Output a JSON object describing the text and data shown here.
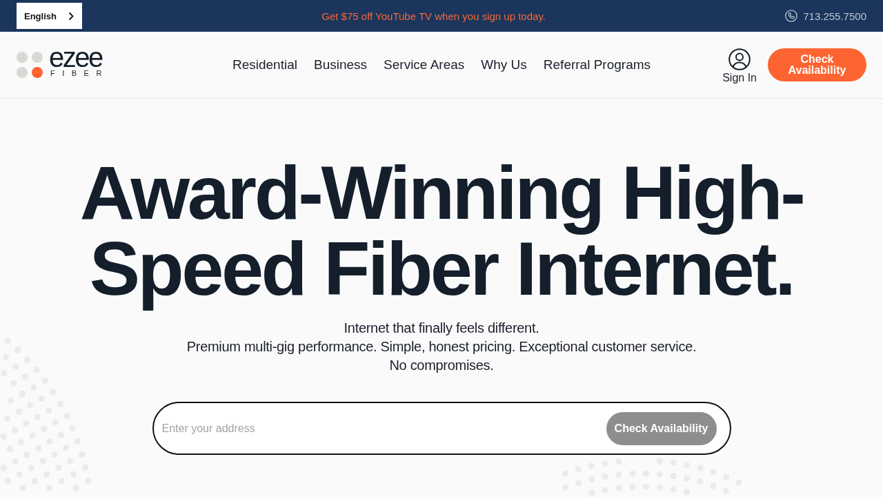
{
  "top_bar": {
    "language_button": {
      "label": "English"
    },
    "promo": "Get $75 off YouTube TV when you sign up today.",
    "phone": "713.255.7500"
  },
  "header": {
    "logo": {
      "wordmark": "ezee",
      "tagline": "FIBER"
    },
    "nav": [
      "Residential",
      "Business",
      "Service Areas",
      "Why Us",
      "Referral Programs"
    ],
    "sign_in": "Sign In",
    "cta_button": "Check Availability"
  },
  "hero": {
    "headline": "Award-Winning High-Speed Fiber Internet.",
    "subtitle_lines": [
      "Internet that finally feels different.",
      "Premium multi-gig performance. Simple, honest pricing. Exceptional customer service.",
      "No compromises."
    ],
    "address_form": {
      "placeholder": "Enter your address",
      "button": "Check Availability",
      "disabled": true
    }
  }
}
